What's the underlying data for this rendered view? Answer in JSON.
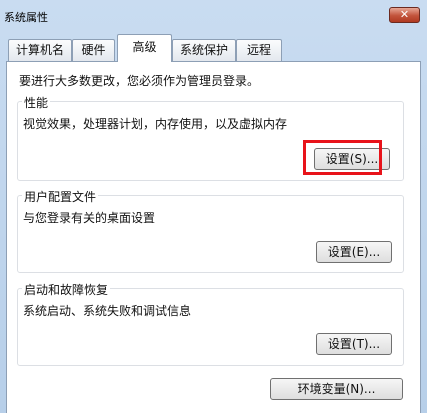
{
  "window": {
    "title": "系统属性",
    "close_label": "✕"
  },
  "tabs": [
    {
      "label": "计算机名"
    },
    {
      "label": "硬件"
    },
    {
      "label": "高级"
    },
    {
      "label": "系统保护"
    },
    {
      "label": "远程"
    }
  ],
  "notice": "要进行大多数更改，您必须作为管理员登录。",
  "performance": {
    "title": "性能",
    "description": "视觉效果，处理器计划，内存使用，以及虚拟内存",
    "button": "设置(S)..."
  },
  "user_profiles": {
    "title": "用户配置文件",
    "description": "与您登录有关的桌面设置",
    "button": "设置(E)..."
  },
  "startup_recovery": {
    "title": "启动和故障恢复",
    "description": "系统启动、系统失败和调试信息",
    "button": "设置(T)..."
  },
  "env_button": "环境变量(N)...",
  "colors": {
    "highlight": "#e8131a"
  }
}
